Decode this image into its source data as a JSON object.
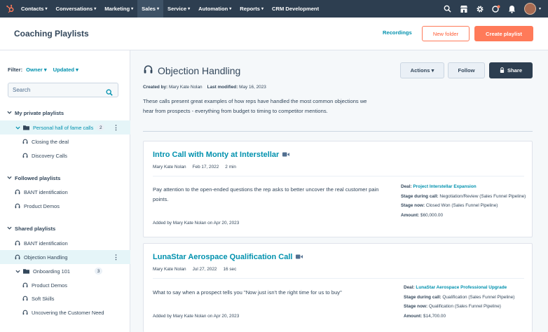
{
  "nav": {
    "items": [
      {
        "label": "Contacts",
        "active": false
      },
      {
        "label": "Conversations",
        "active": false
      },
      {
        "label": "Marketing",
        "active": false
      },
      {
        "label": "Sales",
        "active": true
      },
      {
        "label": "Service",
        "active": false
      },
      {
        "label": "Automation",
        "active": false
      },
      {
        "label": "Reports",
        "active": false
      },
      {
        "label": "CRM Development",
        "active": false,
        "no_caret": true
      }
    ],
    "caret": "▾",
    "right_icons": [
      "search-icon",
      "marketplace-icon",
      "settings-icon",
      "help-icon",
      "notifications-icon"
    ]
  },
  "header": {
    "title": "Coaching Playlists",
    "recordings": "Recordings",
    "new_folder": "New folder",
    "create_playlist": "Create playlist"
  },
  "sidebar": {
    "filter_label": "Filter:",
    "owner": "Owner ▾",
    "updated": "Updated ▾",
    "search_placeholder": "Search",
    "sections": {
      "private": "My private playlists",
      "followed": "Followed playlists",
      "shared": "Shared playlists"
    },
    "private_items": {
      "folder": "Personal hall of fame calls",
      "folder_count": "2",
      "children": [
        "Closing the deal",
        "Discovery Calls"
      ]
    },
    "followed_items": [
      "BANT identification",
      "Product Demos"
    ],
    "shared_items": {
      "bant": "BANT identification",
      "objection": "Objection Handling",
      "folder": "Onboarding 101",
      "folder_count": "3",
      "children": [
        "Product Demos",
        "Soft Skills",
        "Uncovering the Customer Need"
      ]
    }
  },
  "playlist": {
    "title": "Objection Handling",
    "created_by_label": "Created by:",
    "created_by": "Mary Kate Nolan",
    "modified_label": "Last modified:",
    "modified": "May 16, 2023",
    "description": "These calls present great examples of how reps have handled the most common objections we hear from prospects - everything from budget to timing to competitor mentions.",
    "actions": "Actions ▾",
    "follow": "Follow",
    "share": "Share"
  },
  "calls": [
    {
      "title": "Intro Call with Monty at Interstellar",
      "rep": "Mary Kate Nolan",
      "date": "Feb 17, 2022",
      "duration": "2 min",
      "note": "Pay attention to the open-ended questions the rep asks to better uncover the real customer pain points.",
      "added": "Added by Mary Kate Nolan on Apr 20, 2023",
      "deal_label": "Deal:",
      "deal": "Project Interstellar Expansion",
      "stage_during_label": "Stage during call:",
      "stage_during": "Negotiation/Review (Sales Funnel Pipeline)",
      "stage_now_label": "Stage now:",
      "stage_now": "Closed Won (Sales Funnel Pipeline)",
      "amount_label": "Amount:",
      "amount": "$60,000.00"
    },
    {
      "title": "LunaStar Aerospace Qualification Call",
      "rep": "Mary Kate Nolan",
      "date": "Jul 27, 2022",
      "duration": "16 sec",
      "note": "What to say when a prospect tells you \"Now just isn't the right time for us to buy\"",
      "added": "Added by Mary Kate Nolan on Apr 20, 2023",
      "deal_label": "Deal:",
      "deal": "LunaStar Aerospace Professional Upgrade",
      "stage_during_label": "Stage during call:",
      "stage_during": "Qualification (Sales Funnel Pipeline)",
      "stage_now_label": "Stage now:",
      "stage_now": "Qualification (Sales Funnel Pipeline)",
      "amount_label": "Amount:",
      "amount": "$14,700.00"
    }
  ],
  "colors": {
    "nav_bg": "#2d3e50",
    "accent_orange": "#ff7a59",
    "link_teal": "#0091ae",
    "selected_bg": "#e5f5f8"
  }
}
